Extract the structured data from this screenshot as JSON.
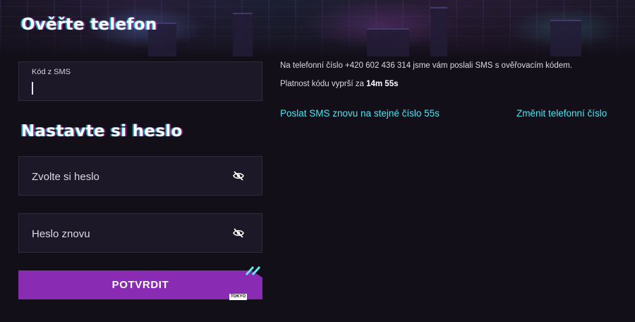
{
  "verify": {
    "title": "Ověřte telefon",
    "sms_label": "Kód z SMS",
    "sms_value": "",
    "info_line": "Na telefonní číslo +420 602 436 314 jsme vám poslali SMS s ověřovacím kódem.",
    "validity_prefix": "Platnost kódu vyprší za ",
    "validity_time": "14m 55s",
    "resend_link": "Poslat SMS znovu na stejné číslo 55s",
    "change_phone_link": "Změnit telefonní číslo"
  },
  "password": {
    "title": "Nastavte si heslo",
    "field1_placeholder": "Zvolte si heslo",
    "field2_placeholder": "Heslo znovu",
    "eye_icon": "eye-slash-icon"
  },
  "submit": {
    "label": "POTVRDIT",
    "badge": "TOKYO"
  },
  "colors": {
    "background": "#130f19",
    "field": "#1c1828",
    "button": "#8a2bb3",
    "link": "#4fe3f0"
  }
}
